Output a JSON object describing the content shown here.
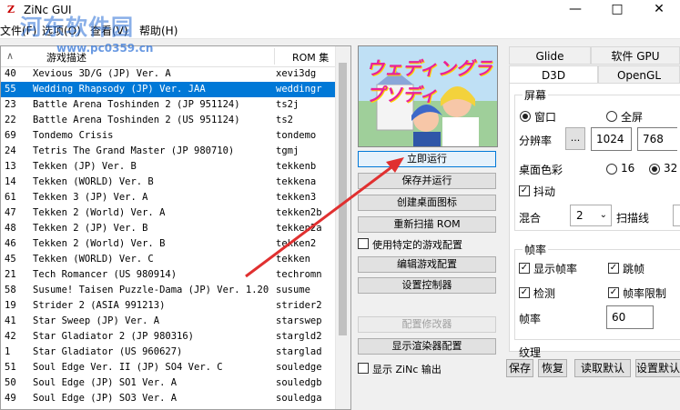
{
  "window": {
    "title": "ZiNc GUI",
    "icon_text": "Z"
  },
  "watermark": {
    "text": "河东软件园",
    "url": "www.pc0359.cn"
  },
  "menu": [
    "文件(F)",
    "选项(O)",
    "查看(V)",
    "帮助(H)"
  ],
  "list": {
    "headers": {
      "name": "游戏描述",
      "rom": "ROM 集"
    },
    "rows": [
      {
        "num": "40",
        "name": "Xevious 3D/G (JP) Ver. A",
        "rom": "xevi3dg"
      },
      {
        "num": "55",
        "name": "Wedding Rhapsody (JP) Ver. JAA",
        "rom": "weddingr",
        "selected": true
      },
      {
        "num": "23",
        "name": "Battle Arena Toshinden 2 (JP 951124)",
        "rom": "ts2j"
      },
      {
        "num": "22",
        "name": "Battle Arena Toshinden 2 (US 951124)",
        "rom": "ts2"
      },
      {
        "num": "69",
        "name": "Tondemo Crisis",
        "rom": "tondemo"
      },
      {
        "num": "24",
        "name": "Tetris The Grand Master (JP 980710)",
        "rom": "tgmj"
      },
      {
        "num": "13",
        "name": "Tekken (JP) Ver. B",
        "rom": "tekkenb"
      },
      {
        "num": "14",
        "name": "Tekken (WORLD) Ver. B",
        "rom": "tekkena"
      },
      {
        "num": "61",
        "name": "Tekken 3 (JP) Ver. A",
        "rom": "tekken3"
      },
      {
        "num": "47",
        "name": "Tekken 2 (World) Ver. A",
        "rom": "tekken2b"
      },
      {
        "num": "48",
        "name": "Tekken 2 (JP) Ver. B",
        "rom": "tekken2a"
      },
      {
        "num": "46",
        "name": "Tekken 2 (World) Ver. B",
        "rom": "tekken2"
      },
      {
        "num": "45",
        "name": "Tekken (WORLD) Ver. C",
        "rom": "tekken"
      },
      {
        "num": "21",
        "name": "Tech Romancer (US 980914)",
        "rom": "techromn"
      },
      {
        "num": "58",
        "name": "Susume! Taisen Puzzle-Dama (JP) Ver. 1.20",
        "rom": "susume"
      },
      {
        "num": "19",
        "name": "Strider 2 (ASIA 991213)",
        "rom": "strider2"
      },
      {
        "num": "41",
        "name": "Star Sweep (JP) Ver. A",
        "rom": "starswep"
      },
      {
        "num": "42",
        "name": "Star Gladiator 2 (JP 980316)",
        "rom": "stargld2"
      },
      {
        "num": "1",
        "name": "Star Gladiator (US 960627)",
        "rom": "starglad"
      },
      {
        "num": "51",
        "name": "Soul Edge Ver. II (JP) SO4 Ver. C",
        "rom": "souledge"
      },
      {
        "num": "50",
        "name": "Soul Edge (JP) SO1 Ver. A",
        "rom": "souledgb"
      },
      {
        "num": "49",
        "name": "Soul Edge (JP) SO3 Ver. A",
        "rom": "souledga"
      }
    ]
  },
  "preview": {
    "title": "ウェディングラプソディ"
  },
  "actions": {
    "run_now": "立即运行",
    "save_run": "保存并运行",
    "create_shortcut": "创建桌面图标",
    "rescan": "重新扫描 ROM",
    "use_specific": "使用特定的游戏配置",
    "edit_config": "编辑游戏配置",
    "set_controller": "设置控制器",
    "config_modifier": "配置修改器",
    "show_renderer": "显示渲染器配置",
    "show_output": "显示 ZiNc 输出"
  },
  "tabs": {
    "glide": "Glide",
    "soft_gpu": "软件 GPU",
    "d3d": "D3D",
    "opengl": "OpenGL"
  },
  "screen": {
    "group": "屏幕",
    "window": "窗口",
    "fullscreen": "全屏",
    "resolution_label": "分辨率",
    "res_button": "...",
    "width": "1024",
    "height": "768",
    "color_label": "桌面色彩",
    "color16": "16",
    "color32": "32",
    "dither": "抖动",
    "mix_label": "混合",
    "mix_value": "2",
    "scanline": "扫描线"
  },
  "framerate": {
    "group": "帧率",
    "show_fps": "显示帧率",
    "skip": "跳帧",
    "detect": "检测",
    "limit": "帧率限制",
    "rate_label": "帧率",
    "rate_value": "60"
  },
  "misc": {
    "group": "纹理"
  },
  "bottom": {
    "save": "保存",
    "restore": "恢复",
    "load_default": "读取默认",
    "set_default": "设置默认"
  },
  "colors": {
    "accent": "#0078d7",
    "arrow": "#e03030"
  }
}
